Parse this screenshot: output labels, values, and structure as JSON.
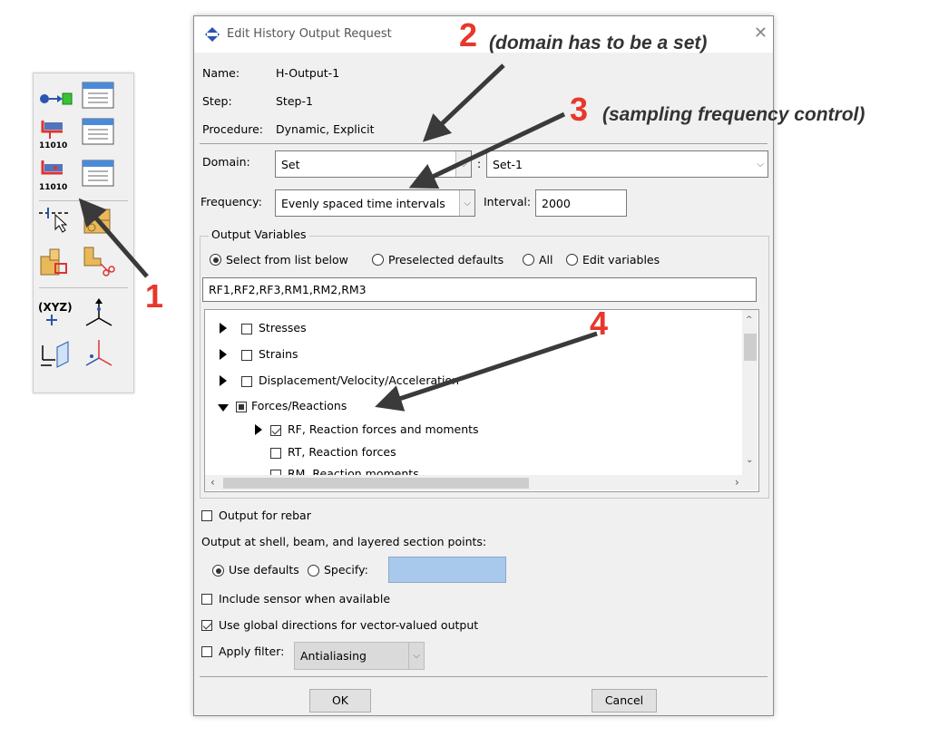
{
  "dialog": {
    "title": "Edit History Output Request",
    "name_label": "Name:",
    "name_value": "H-Output-1",
    "step_label": "Step:",
    "step_value": "Step-1",
    "procedure_label": "Procedure:",
    "procedure_value": "Dynamic, Explicit",
    "domain_label": "Domain:",
    "domain_value": "Set",
    "domain_colon": ":",
    "set_value": "Set-1",
    "frequency_label": "Frequency:",
    "frequency_value": "Evenly spaced time intervals",
    "interval_label": "Interval:",
    "interval_value": "2000",
    "output_variables": {
      "legend": "Output Variables",
      "options": [
        "Select from list below",
        "Preselected defaults",
        "All",
        "Edit variables"
      ],
      "selected_option": "Select from list below",
      "variables_text": "RF1,RF2,RF3,RM1,RM2,RM3",
      "tree": [
        {
          "label": "Stresses",
          "state": "unchecked",
          "expander": "collapsed"
        },
        {
          "label": "Strains",
          "state": "unchecked",
          "expander": "collapsed"
        },
        {
          "label": "Displacement/Velocity/Acceleration",
          "state": "unchecked",
          "expander": "collapsed"
        },
        {
          "label": "Forces/Reactions",
          "state": "partial",
          "expander": "expanded"
        },
        {
          "label": "RF, Reaction forces and moments",
          "state": "checked",
          "expander": "collapsed"
        },
        {
          "label": "RT, Reaction forces",
          "state": "unchecked",
          "expander": "none"
        },
        {
          "label": "RM, Reaction moments",
          "state": "unchecked",
          "expander": "none"
        }
      ]
    },
    "output_for_rebar": {
      "label": "Output for rebar",
      "checked": false
    },
    "section_points_label": "Output at shell, beam, and layered section points:",
    "use_defaults_label": "Use defaults",
    "specify_label": "Specify:",
    "specify_value": "",
    "include_sensor": {
      "label": "Include sensor when available",
      "checked": false
    },
    "global_directions": {
      "label": "Use global directions for vector-valued output",
      "checked": true
    },
    "apply_filter": {
      "label": "Apply filter:",
      "checked": false
    },
    "filter_value": "Antialiasing",
    "ok_label": "OK",
    "cancel_label": "Cancel"
  },
  "annotations": {
    "n1": "1",
    "n2": "2",
    "t2": "(domain has to be a set)",
    "n3": "3",
    "t3": "(sampling frequency control)",
    "n4": "4"
  },
  "toolbox": {
    "icons": [
      "history-output-manager-icon",
      "history-output-create-icon",
      "field-output-create-icon",
      "history-output-edit-icon",
      "field-output-edit-icon",
      "query-point-icon",
      "partition-icon",
      "assign-section-icon",
      "cut-icon",
      "datum-csys-icon",
      "datum-axis-icon",
      "datum-plane-icon",
      "datum-point-icon"
    ],
    "coord_label": "(XYZ)"
  },
  "colors": {
    "annotation": "#e8372b",
    "accent_blue": "#2a6ad1",
    "specify_field": "#a9c9ec"
  }
}
